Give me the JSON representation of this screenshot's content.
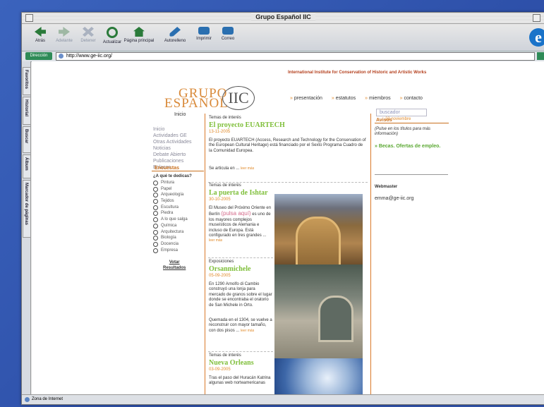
{
  "window": {
    "title": "Grupo Español IIC"
  },
  "toolbar": {
    "back": "Atrás",
    "forward": "Adelante",
    "stop": "Detener",
    "refresh": "Actualizar",
    "home": "Página principal",
    "autofill": "Autorelleno",
    "print": "Imprimir",
    "mail": "Correo"
  },
  "address": {
    "label": "Dirección",
    "url": "http://www.ge-iic.org/"
  },
  "sidetabs": [
    "Favoritos",
    "Historial",
    "Buscar",
    "Álbum",
    "Marcador de páginas"
  ],
  "status": "Zona de Internet",
  "site": {
    "logo_line1": "GRUPO",
    "logo_line2": "ESPAÑOL",
    "logo_mark": "IIC",
    "institute": "International Institute for Conservation of Historic and Artistic Works",
    "nav": [
      "presentación",
      "estatutos",
      "miembros",
      "contacto"
    ],
    "search_placeholder": "buscador",
    "date": "23 noviembre",
    "breadcrumb": "Inicio",
    "left_menu": [
      "Inicio",
      "Actividades GE",
      "Otras Actividades",
      "Noticias",
      "Debate Abierto",
      "Publicaciones",
      "Enlaces"
    ],
    "poll": {
      "title": "Encuestas",
      "question": "¿A qué te dedicas?",
      "options": [
        "Pintura",
        "Papel",
        "Arqueología",
        "Tejidos",
        "Escultura",
        "Piedra",
        "A lo que salga",
        "Química",
        "Arquitectura",
        "Biología",
        "Docencia",
        "Empresa"
      ],
      "vote": "Votar",
      "results": "Resultados"
    },
    "articles": [
      {
        "label": "Temas de interés",
        "title": "El proyecto EUARTECH",
        "date": "13-11-2005",
        "text": "El proyecto EUARTECH (Access, Research and Technology for the Conservation of the European Cultural Heritage) está financiado por el Sexto Programa Cuadro de la Comunidad Europea.",
        "text2": "Se articula en ...",
        "more": "leer más"
      },
      {
        "label": "Temas de interés",
        "title": "La puerta de Ishtar",
        "date": "30-10-2005",
        "text_a": "El Museo del Próximo Oriente en Berlín ",
        "link": "(pulsa aquí)",
        "text_b": " es uno de los mayores complejos museísticos de Alemania e incluso de Europa. Está configurado en tres grandes ...",
        "more": "leer más"
      },
      {
        "label": "Exposiciones",
        "title": "Orsanmichele",
        "date": "05-09-2005",
        "text": "En 1290 Arnolfo di Cambio construyó una lonja para mercado de granos sobre el lugar donde se encontraba el oratorio de San Michele in Orto.",
        "text2": "Quemada en el 1304, se vuelve a reconstruir con mayor tamaño, con dos pisos ...",
        "more": "leer más"
      },
      {
        "label": "Temas de interés",
        "title": "Nueva Orleans",
        "date": "03-09-2005",
        "text": "Tras el paso del Huracán Katrina algunas web norteamericanas"
      }
    ],
    "avisos": {
      "title": "Avisos",
      "note": "(Pulse en los títulos para más información)",
      "item": "» Becas. Ofertas de empleo."
    },
    "webmaster": "Webmaster",
    "email": "emma@ge-iic.org"
  },
  "colors": {
    "accent": "#d9792a",
    "title_green": "#7fbf3a",
    "desktop": "#2f55b0"
  }
}
